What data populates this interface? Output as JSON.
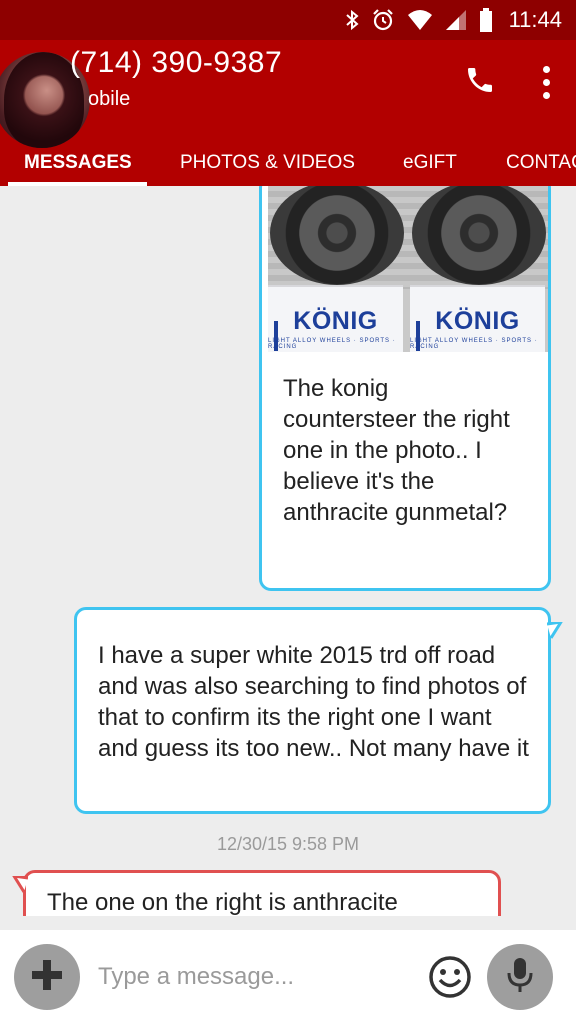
{
  "status_bar": {
    "time": "11:44",
    "icons": [
      "bluetooth-icon",
      "alarm-icon",
      "wifi-icon",
      "signal-icon",
      "battery-icon"
    ]
  },
  "header": {
    "contact_number": "(714) 390-9387",
    "contact_type": "obile",
    "actions": [
      "phone-icon",
      "more-vert-icon"
    ]
  },
  "tabs": [
    {
      "label": "MESSAGES",
      "active": true
    },
    {
      "label": "PHOTOS & VIDEOS",
      "active": false
    },
    {
      "label": "eGIFT",
      "active": false
    },
    {
      "label": "CONTAC",
      "active": false
    }
  ],
  "photo": {
    "brand_left": "KÖNIG",
    "brand_right": "KÖNIG",
    "sub_left": "LIGHT ALLOY WHEELS · SPORTS · RACING",
    "sub_right": "LIGHT ALLOY WHEELS · SPORTS · RACING"
  },
  "messages": [
    {
      "direction": "incoming",
      "text": "The konig countersteer   the right one in the photo.. I believe it's the anthracite gunmetal?"
    },
    {
      "direction": "outgoing",
      "text": "I have a super white 2015 trd off road  and was also searching to find photos of that to confirm its the right one I want and guess its too new.. Not many have it"
    },
    {
      "direction": "incoming",
      "text": "The one on the right is anthracite"
    }
  ],
  "timestamp": "12/30/15 9:58 PM",
  "composer": {
    "placeholder": "Type a message..."
  },
  "colors": {
    "status_bar": "#8e0000",
    "header": "#b20000",
    "bubble_blue_border": "#3fc4f0",
    "bubble_red_border": "#e05050",
    "background": "#ededed"
  }
}
